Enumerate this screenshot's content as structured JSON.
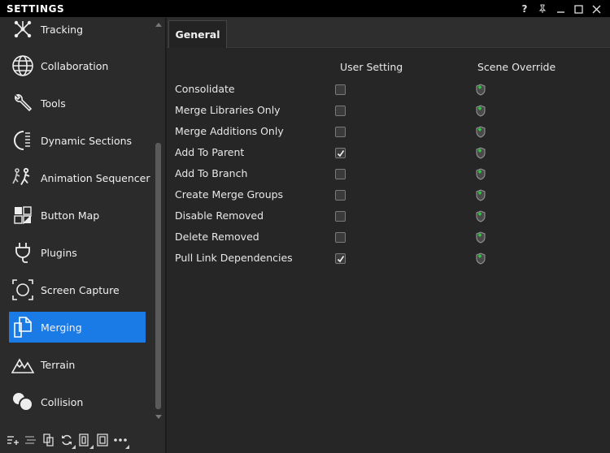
{
  "window": {
    "title": "SETTINGS",
    "controls": [
      "?",
      "pin-icon",
      "minimize-icon",
      "maximize-icon",
      "close-icon"
    ]
  },
  "sidebar": {
    "items": [
      {
        "label": "Tracking",
        "icon": "tracking-icon",
        "active": false
      },
      {
        "label": "Collaboration",
        "icon": "collaboration-icon",
        "active": false
      },
      {
        "label": "Tools",
        "icon": "wrench-icon",
        "active": false
      },
      {
        "label": "Dynamic Sections",
        "icon": "dynamic-sections-icon",
        "active": false
      },
      {
        "label": "Animation Sequencer",
        "icon": "animation-sequencer-icon",
        "active": false
      },
      {
        "label": "Button Map",
        "icon": "button-map-icon",
        "active": false
      },
      {
        "label": "Plugins",
        "icon": "plug-icon",
        "active": false
      },
      {
        "label": "Screen Capture",
        "icon": "screen-capture-icon",
        "active": false
      },
      {
        "label": "Merging",
        "icon": "merging-icon",
        "active": true
      },
      {
        "label": "Terrain",
        "icon": "terrain-icon",
        "active": false
      },
      {
        "label": "Collision",
        "icon": "collision-icon",
        "active": false
      }
    ],
    "toolbar": [
      "add-icon",
      "list-icon",
      "copy-icon",
      "refresh-icon",
      "layout-icon",
      "frame-icon",
      "more-icon"
    ]
  },
  "tabs": [
    {
      "label": "General",
      "active": true
    }
  ],
  "table": {
    "columns": [
      "User Setting",
      "Scene Override"
    ],
    "rows": [
      {
        "label": "Consolidate",
        "checked": false
      },
      {
        "label": "Merge Libraries Only",
        "checked": false
      },
      {
        "label": "Merge Additions Only",
        "checked": false
      },
      {
        "label": "Add To Parent",
        "checked": true
      },
      {
        "label": "Add To Branch",
        "checked": false
      },
      {
        "label": "Create Merge Groups",
        "checked": false
      },
      {
        "label": "Disable Removed",
        "checked": false
      },
      {
        "label": "Delete Removed",
        "checked": false
      },
      {
        "label": "Pull Link Dependencies",
        "checked": true
      }
    ]
  },
  "colors": {
    "accent": "#1a7ae6",
    "override_plus": "#2ecc40"
  }
}
